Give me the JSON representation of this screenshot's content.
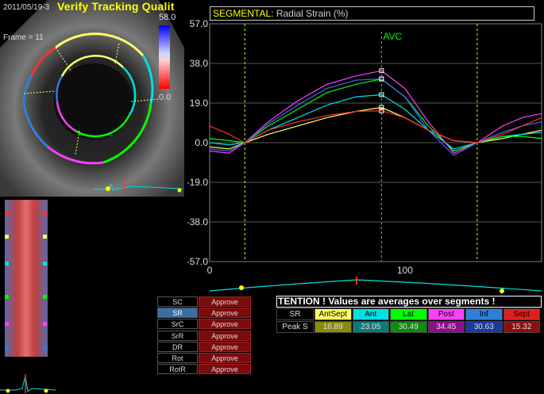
{
  "header": {
    "date": "2011/05/19-3",
    "title": "Verify Tracking Qualit",
    "frame": "Frame = 11",
    "scale_max": "58.0",
    "scale_mid": "0.0"
  },
  "chart_title": {
    "label": "SEGMENTAL:",
    "measure": "Radial Strain (%)"
  },
  "chart_data": {
    "type": "line",
    "title": "SEGMENTAL: Radial Strain (%)",
    "ylim": [
      -57,
      57
    ],
    "yticks": [
      "57.0",
      "38.0",
      "19.0",
      "0.0",
      "-19.0",
      "-38.0",
      "-57.0"
    ],
    "xlim": [
      0,
      170
    ],
    "xticks": [
      "0",
      "100"
    ],
    "marker_label": "AVC",
    "marker_x": 88,
    "vlines_x": [
      18,
      137
    ],
    "x": [
      0,
      10,
      18,
      30,
      45,
      60,
      75,
      88,
      100,
      112,
      125,
      137,
      150,
      160,
      170
    ],
    "series": [
      {
        "name": "AntSept",
        "color": "#ffff66",
        "values": [
          -2,
          -3,
          0,
          4,
          8,
          12,
          15,
          16.9,
          12,
          6,
          1,
          0,
          2,
          4,
          6
        ]
      },
      {
        "name": "Ant",
        "color": "#00e0e0",
        "values": [
          0,
          -1,
          0,
          6,
          12,
          18,
          22,
          23.0,
          16,
          6,
          -3,
          0,
          3,
          4,
          5
        ]
      },
      {
        "name": "Lat",
        "color": "#00ff00",
        "values": [
          2,
          1,
          0,
          8,
          16,
          24,
          28,
          30.5,
          22,
          8,
          -4,
          0,
          3,
          3,
          2
        ]
      },
      {
        "name": "Post",
        "color": "#ff40ff",
        "values": [
          -4,
          -5,
          0,
          10,
          20,
          28,
          32,
          34.5,
          26,
          10,
          -5,
          0,
          8,
          12,
          14
        ]
      },
      {
        "name": "Inf",
        "color": "#4466ff",
        "values": [
          -3,
          -4,
          0,
          9,
          18,
          26,
          30,
          30.6,
          22,
          6,
          -6,
          0,
          5,
          8,
          10
        ]
      },
      {
        "name": "Sept",
        "color": "#ff3030",
        "values": [
          8,
          4,
          0,
          6,
          10,
          13,
          15,
          15.3,
          12,
          6,
          1,
          0,
          4,
          8,
          12
        ]
      }
    ]
  },
  "methods": [
    {
      "label": "SC",
      "selected": false,
      "action": "Approve"
    },
    {
      "label": "SR",
      "selected": true,
      "action": "Approve"
    },
    {
      "label": "SrC",
      "selected": false,
      "action": "Approve"
    },
    {
      "label": "SrR",
      "selected": false,
      "action": "Approve"
    },
    {
      "label": "DR",
      "selected": false,
      "action": "Approve"
    },
    {
      "label": "Rot",
      "selected": false,
      "action": "Approve"
    },
    {
      "label": "RotR",
      "selected": false,
      "action": "Approve"
    }
  ],
  "attention": "TENTION !  Values are averages over segments !",
  "segments_table": {
    "row1_label": "SR",
    "row2_label": "Peak S",
    "segments": [
      {
        "name": "AntSept",
        "value": "16.89",
        "head_bg": "#ffff66",
        "head_fg": "#000000",
        "val_bg": "#8a8a10"
      },
      {
        "name": "Ant",
        "value": "23.05",
        "head_bg": "#00e0e0",
        "head_fg": "#000000",
        "val_bg": "#107a7a"
      },
      {
        "name": "Lat",
        "value": "30.49",
        "head_bg": "#00ff00",
        "head_fg": "#000000",
        "val_bg": "#108a10"
      },
      {
        "name": "Post",
        "value": "34.45",
        "head_bg": "#ff40ff",
        "head_fg": "#000000",
        "val_bg": "#8a108a"
      },
      {
        "name": "Inf",
        "value": "30.63",
        "head_bg": "#2f7fd8",
        "head_fg": "#000000",
        "val_bg": "#1a3aa0"
      },
      {
        "name": "Sept",
        "value": "15.32",
        "head_bg": "#e02020",
        "head_fg": "#000000",
        "val_bg": "#8a1010"
      }
    ]
  }
}
